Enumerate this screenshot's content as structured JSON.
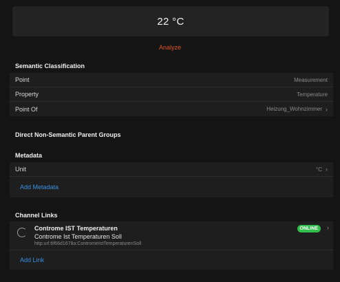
{
  "current_value": "22 °C",
  "analyze_label": "Analyze",
  "semantic": {
    "title": "Semantic Classification",
    "rows": [
      {
        "label": "Point",
        "value": "Measurement"
      },
      {
        "label": "Property",
        "value": "Temperature"
      },
      {
        "label": "Point Of",
        "value": "Heizung_Wohnzimmer"
      }
    ]
  },
  "parent_groups": {
    "title": "Direct Non-Semantic Parent Groups"
  },
  "metadata": {
    "title": "Metadata",
    "rows": [
      {
        "label": "Unit",
        "value": "°C"
      }
    ],
    "add_label": "Add Metadata"
  },
  "channel_links": {
    "title": "Channel Links",
    "items": [
      {
        "title": "Controme IST Temperaturen",
        "subtitle": "Controme Ist Temperaturen Soll",
        "uid": "http:url:6f66d1678a:ContromeIstTemperaturenSoll",
        "status": "ONLINE"
      }
    ],
    "add_label": "Add Link"
  },
  "icons": {
    "chevron": "chevron-right-icon",
    "spinner": "channel-spinner-icon"
  },
  "colors": {
    "accent": "#e0552a",
    "link": "#3b8fe0",
    "online": "#2fbf4a"
  }
}
